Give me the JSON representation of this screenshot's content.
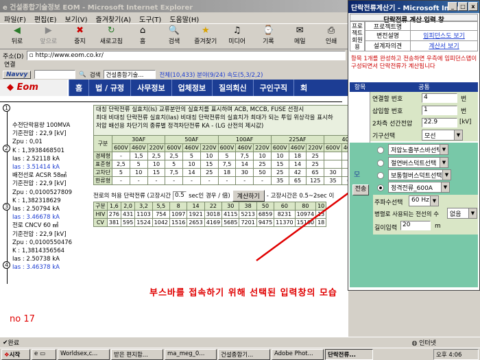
{
  "browser": {
    "title": "건설종합기술정보 EOM - Microsoft Internet Explorer",
    "menu": [
      "파일(F)",
      "편집(E)",
      "보기(V)",
      "즐겨찾기(A)",
      "도구(T)",
      "도움말(H)"
    ],
    "toolbar": [
      "뒤로",
      "앞으로",
      "중지",
      "새로고침",
      "홈",
      "검색",
      "즐겨찾기",
      "미디어",
      "기록",
      "메일",
      "인쇄"
    ],
    "address_label": "주소(D)",
    "address": "http://www.eom.co.kr/",
    "links_label": "연결",
    "navvy": "Navvy",
    "search_label": "검색",
    "search_value": "건설종합기술...",
    "search_stats": "전체(10,433)  분야(9/24)  속도(5,3/2,2)"
  },
  "site": {
    "logo": "Eom",
    "nav": [
      "홈",
      "법 / 규정",
      "사무정보",
      "업체정보",
      "질의회신",
      "구인구직",
      "회"
    ]
  },
  "diagram": {
    "nodes": [
      "1",
      "2",
      "3",
      "4"
    ],
    "lines": [
      {
        "t": "수전단락용량 100MVA",
        "c": false
      },
      {
        "t": "기준전압 : 22,9 [kV]",
        "c": false
      },
      {
        "t": "Zpu : 0,01",
        "c": false
      },
      {
        "t": "K : 1,3938468501",
        "c": false
      },
      {
        "t": "Ias : 2.52118 kA",
        "c": false
      },
      {
        "t": "Ias : 3.51414 kA",
        "c": true
      },
      {
        "t": "배전선로 ACSR 58㎟",
        "c": false
      },
      {
        "t": "기준전압 : 22,9 [kV]",
        "c": false
      },
      {
        "t": "Zpu : 0,0100527809",
        "c": false
      },
      {
        "t": "K : 1,382318629",
        "c": false
      },
      {
        "t": "Ias : 2.50794 kA",
        "c": false
      },
      {
        "t": "Ias : 3.46678 kA",
        "c": true
      },
      {
        "t": "전로 CNCV 60 ㎟",
        "c": false
      },
      {
        "t": "기준전압 : 22,9 [kV]",
        "c": false
      },
      {
        "t": "Zpu : 0,0100550476",
        "c": false
      },
      {
        "t": "K : 1,3814356564",
        "c": false
      },
      {
        "t": "Ias : 2.50738 kA",
        "c": false
      },
      {
        "t": "Ias : 3.46378 kA",
        "c": true
      }
    ]
  },
  "table1": {
    "line1": "대칭 단락전류 실효치(Is)       교류분만의 실효치를 표시하며 ACB, MCCB, FUSE 선정시",
    "line2": "최대 비대칭 단락전류 실효치(Ias)  비대칭 단락전류의 실효치가 최대가 되는 투입 위상각을 표시하",
    "line3": "저압 배선용 차단기의 종류별 정격차단전류 KA - (LG 산전의 제시값)",
    "col_groups": [
      "구분",
      "30AF",
      "50AF",
      "100AF",
      "225AF",
      "400AF"
    ],
    "volts": [
      "600V",
      "460V",
      "220V",
      "600V",
      "460V",
      "220V",
      "600V",
      "460V",
      "220V",
      "600V",
      "460V",
      "220V",
      "600V",
      "460V",
      "220V"
    ],
    "rows": [
      [
        "경제형",
        "-",
        "1,5",
        "2,5",
        "2,5",
        "5",
        "10",
        "5",
        "7,5",
        "10",
        "10",
        "18",
        "25",
        "",
        "",
        ""
      ],
      [
        "표준형",
        "2,5",
        "5",
        "10",
        "5",
        "10",
        "15",
        "7,5",
        "14",
        "25",
        "15",
        "14",
        "25",
        "",
        "",
        ""
      ],
      [
        "고차단",
        "5",
        "10",
        "15",
        "7,5",
        "14",
        "25",
        "18",
        "30",
        "50",
        "25",
        "42",
        "65",
        "30",
        "",
        ""
      ],
      [
        "한류형",
        "-",
        "-",
        "-",
        "-",
        "-",
        "-",
        "-",
        "-",
        "-",
        "35",
        "65",
        "125",
        "35",
        "60",
        ""
      ]
    ]
  },
  "table2": {
    "label": "전로의 허용 단락전류 (고장시간",
    "time": "0.5",
    "label2": "sec인 경우 / 倍)",
    "calc_button": "계산하기",
    "note": "- 고장시간은 0.5~2sec 이",
    "rows": [
      [
        "구분",
        "1,6",
        "2,0",
        "3,2",
        "5,5",
        "8",
        "14",
        "22",
        "30",
        "38",
        "50",
        "60",
        "80",
        "10"
      ],
      [
        "HIV",
        "276",
        "431",
        "1103",
        "754",
        "1097",
        "1921",
        "3018",
        "4115",
        "5213",
        "6859",
        "8231",
        "10974",
        "13"
      ],
      [
        "CV",
        "381",
        "595",
        "1524",
        "1042",
        "1516",
        "2653",
        "4169",
        "5685",
        "7201",
        "9475",
        "11370",
        "15160",
        "18"
      ]
    ]
  },
  "annotation": {
    "text": "부스바를 접속하기 위해 선택된 입력창의 모습",
    "number": "no 17"
  },
  "status": {
    "text": "완료",
    "zone": "인터넷"
  },
  "popup": {
    "title": "단락전류계산기 - Microsoft Intern...",
    "header": "단락전류 계산 입력 창",
    "side_label": "프로젝트회원용",
    "rows": [
      {
        "label": "프로젝트명",
        "value": ""
      },
      {
        "label": "변전설명",
        "value": "임피던스도 보기"
      },
      {
        "label": "설계자의견",
        "value": "계산서 보기"
      }
    ],
    "notice": "항목 1개를 완성하고 전송하면 우측에 임피던스맵이 구성되면서 단락전류가 계산됩니다",
    "col_item": "항목",
    "col_common": "공통",
    "inputs": [
      {
        "label": "연결할 번호",
        "value": "4",
        "unit": "번"
      },
      {
        "label": "삽입할 번호",
        "value": "1",
        "unit": "번"
      },
      {
        "label": "2차측 선간전압",
        "value": "22.9",
        "unit": "[kV]"
      },
      {
        "label": "기구선택",
        "value": "모선",
        "unit": ""
      }
    ],
    "options": [
      "저압노출부스바선택",
      "절연버스덕트선택",
      "보통형버스덕트선택",
      "정격전류_600A"
    ],
    "side_letter": "모",
    "send_button": "전송",
    "freq_label": "주파수선택",
    "freq_value": "60 Hz",
    "parallel_label": "병렬로 사용되는 전선의 수",
    "parallel_value": "없음",
    "length_label": "길이입력",
    "length_value": "20",
    "length_unit": "m"
  },
  "taskbar": {
    "start": "시작",
    "tasks": [
      "Worldsex,c...",
      "받은 편지함...",
      "ma_meg_0...",
      "건설종합기...",
      "Adobe Phot...",
      "단락전류..."
    ],
    "clock": "오후 4:06"
  }
}
